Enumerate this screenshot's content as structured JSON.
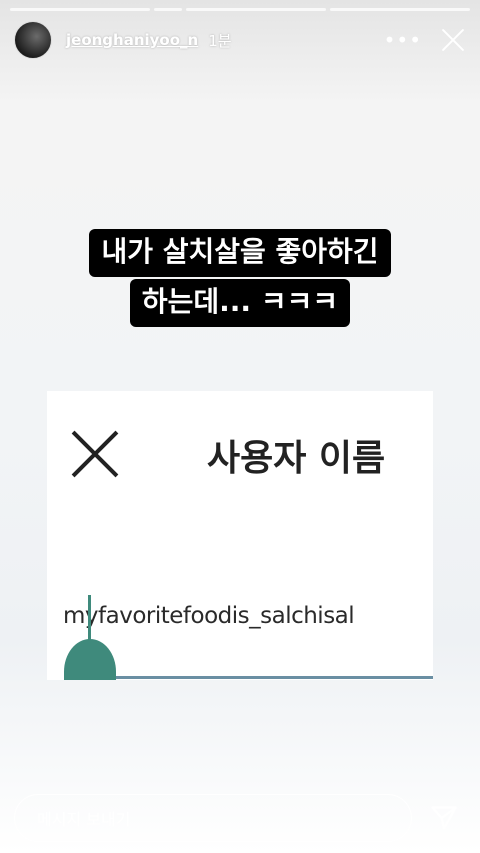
{
  "story": {
    "username": "jeonghaniyoo_n",
    "time": "1분",
    "caption_lines": [
      "내가 살치살을 좋아하긴",
      "하는데... ㅋㅋㅋ"
    ]
  },
  "screenshot_card": {
    "title": "사용자 이름",
    "username_value": "myfavoritefoodis_salchisal"
  },
  "reply": {
    "placeholder": "메시지 보내기"
  },
  "icons": {
    "more": "more-icon",
    "close": "close-icon",
    "send": "send-icon"
  }
}
